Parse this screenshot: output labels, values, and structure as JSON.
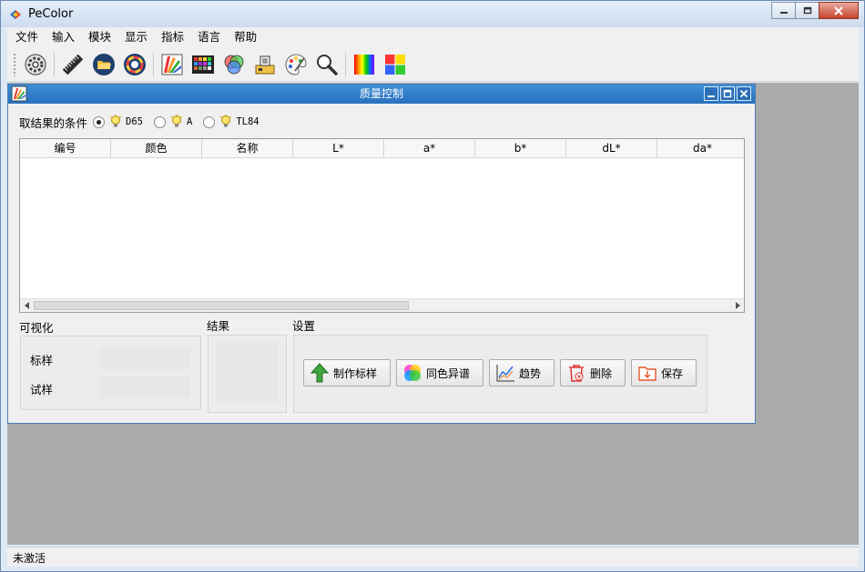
{
  "app": {
    "title": "PeColor",
    "accent": "#2a72bf"
  },
  "menu": [
    "文件",
    "输入",
    "模块",
    "显示",
    "指标",
    "语言",
    "帮助"
  ],
  "toolbar": {
    "icons": [
      "settings-icon",
      "ruler-icon",
      "folder-open-icon",
      "color-wheel-icon",
      "fan-deck-icon",
      "color-grid-icon",
      "rgb-circles-icon",
      "lab-instrument-icon",
      "palette-icon",
      "magnifier-icon",
      "spectrum-icon",
      "color-square-icon"
    ]
  },
  "child_window": {
    "title": "质量控制",
    "conditions": {
      "label": "取结果的条件",
      "options": [
        {
          "label": "D65",
          "selected": true
        },
        {
          "label": "A",
          "selected": false
        },
        {
          "label": "TL84",
          "selected": false
        }
      ]
    },
    "table": {
      "columns": [
        "编号",
        "颜色",
        "名称",
        "L*",
        "a*",
        "b*",
        "dL*",
        "da*"
      ],
      "rows": []
    },
    "visualization": {
      "title": "可视化",
      "standard_label": "标样",
      "trial_label": "试样"
    },
    "result": {
      "title": "结果"
    },
    "settings": {
      "title": "设置",
      "buttons": [
        "制作标样",
        "同色异谱",
        "趋势",
        "删除",
        "保存"
      ]
    }
  },
  "status": {
    "text": "未激活"
  }
}
